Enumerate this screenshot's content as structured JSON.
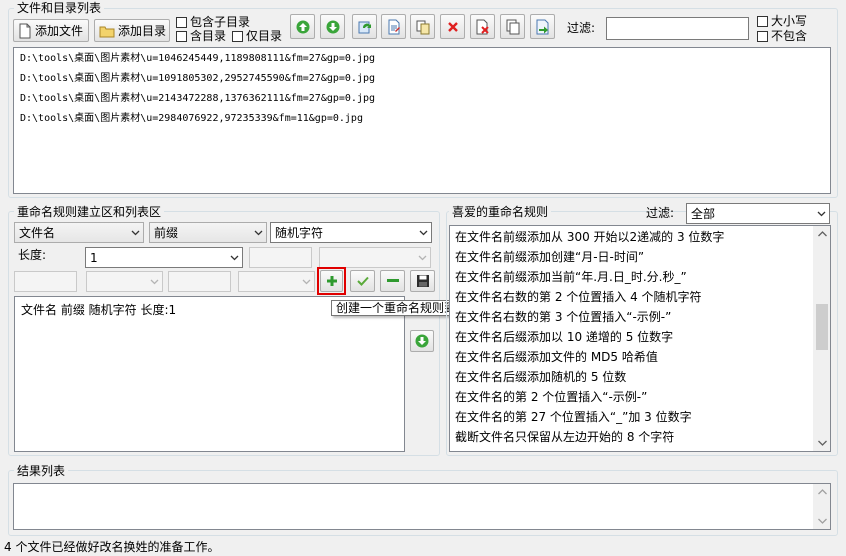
{
  "file_section": {
    "title": "文件和目录列表",
    "add_file_label": "添加文件",
    "add_dir_label": "添加目录",
    "include_subdirs_label": "包含子目录",
    "all_dirs_label": "含目录",
    "only_dirs_label": "仅目录",
    "filter_label": "过滤:",
    "filter_value": "",
    "case_label": "大小写",
    "exclude_label": "不包含",
    "files": [
      "D:\\tools\\桌面\\图片素材\\u=1046245449,1189808111&fm=27&gp=0.jpg",
      "D:\\tools\\桌面\\图片素材\\u=1091805302,2952745590&fm=27&gp=0.jpg",
      "D:\\tools\\桌面\\图片素材\\u=2143472288,1376362111&fm=27&gp=0.jpg",
      "D:\\tools\\桌面\\图片素材\\u=2984076922,97235339&fm=11&gp=0.jpg"
    ]
  },
  "rule_section": {
    "title": "重命名规则建立区和列表区",
    "target_value": "文件名",
    "position_value": "前缀",
    "type_value": "随机字符",
    "length_label": "长度:",
    "length_value": "1",
    "rules": [
      "文件名 前缀 随机字符 长度:1"
    ],
    "tooltip": "创建一个重命名规则到列表区"
  },
  "fav_section": {
    "title": "喜爱的重命名规则",
    "filter_label": "过滤:",
    "filter_value": "全部",
    "items": [
      "在文件名前缀添加从 300 开始以2递减的 3 位数字",
      "在文件名前缀添加创建“月-日-时间”",
      "在文件名前缀添加当前“年.月.日_时.分.秒_”",
      "在文件名右数的第 2 个位置插入 4 个随机字符",
      "在文件名右数的第 3 个位置插入“-示例-”",
      "在文件名后缀添加以 10 递增的 5 位数字",
      "在文件名后缀添加文件的 MD5 哈希值",
      "在文件名后缀添加随机的 5 位数",
      "在文件名的第 2 个位置插入“-示例-”",
      "在文件名的第 27 个位置插入“_”加 3 位数字",
      "截断文件名只保留从左边开始的 8 个字符"
    ]
  },
  "result_section": {
    "title": "结果列表"
  },
  "status": {
    "text": "4 个文件已经做好改名换姓的准备工作。"
  },
  "colors": {
    "add_green": "#2f9a2f",
    "delete_red": "#e02020",
    "highlight_red": "#e00000"
  }
}
